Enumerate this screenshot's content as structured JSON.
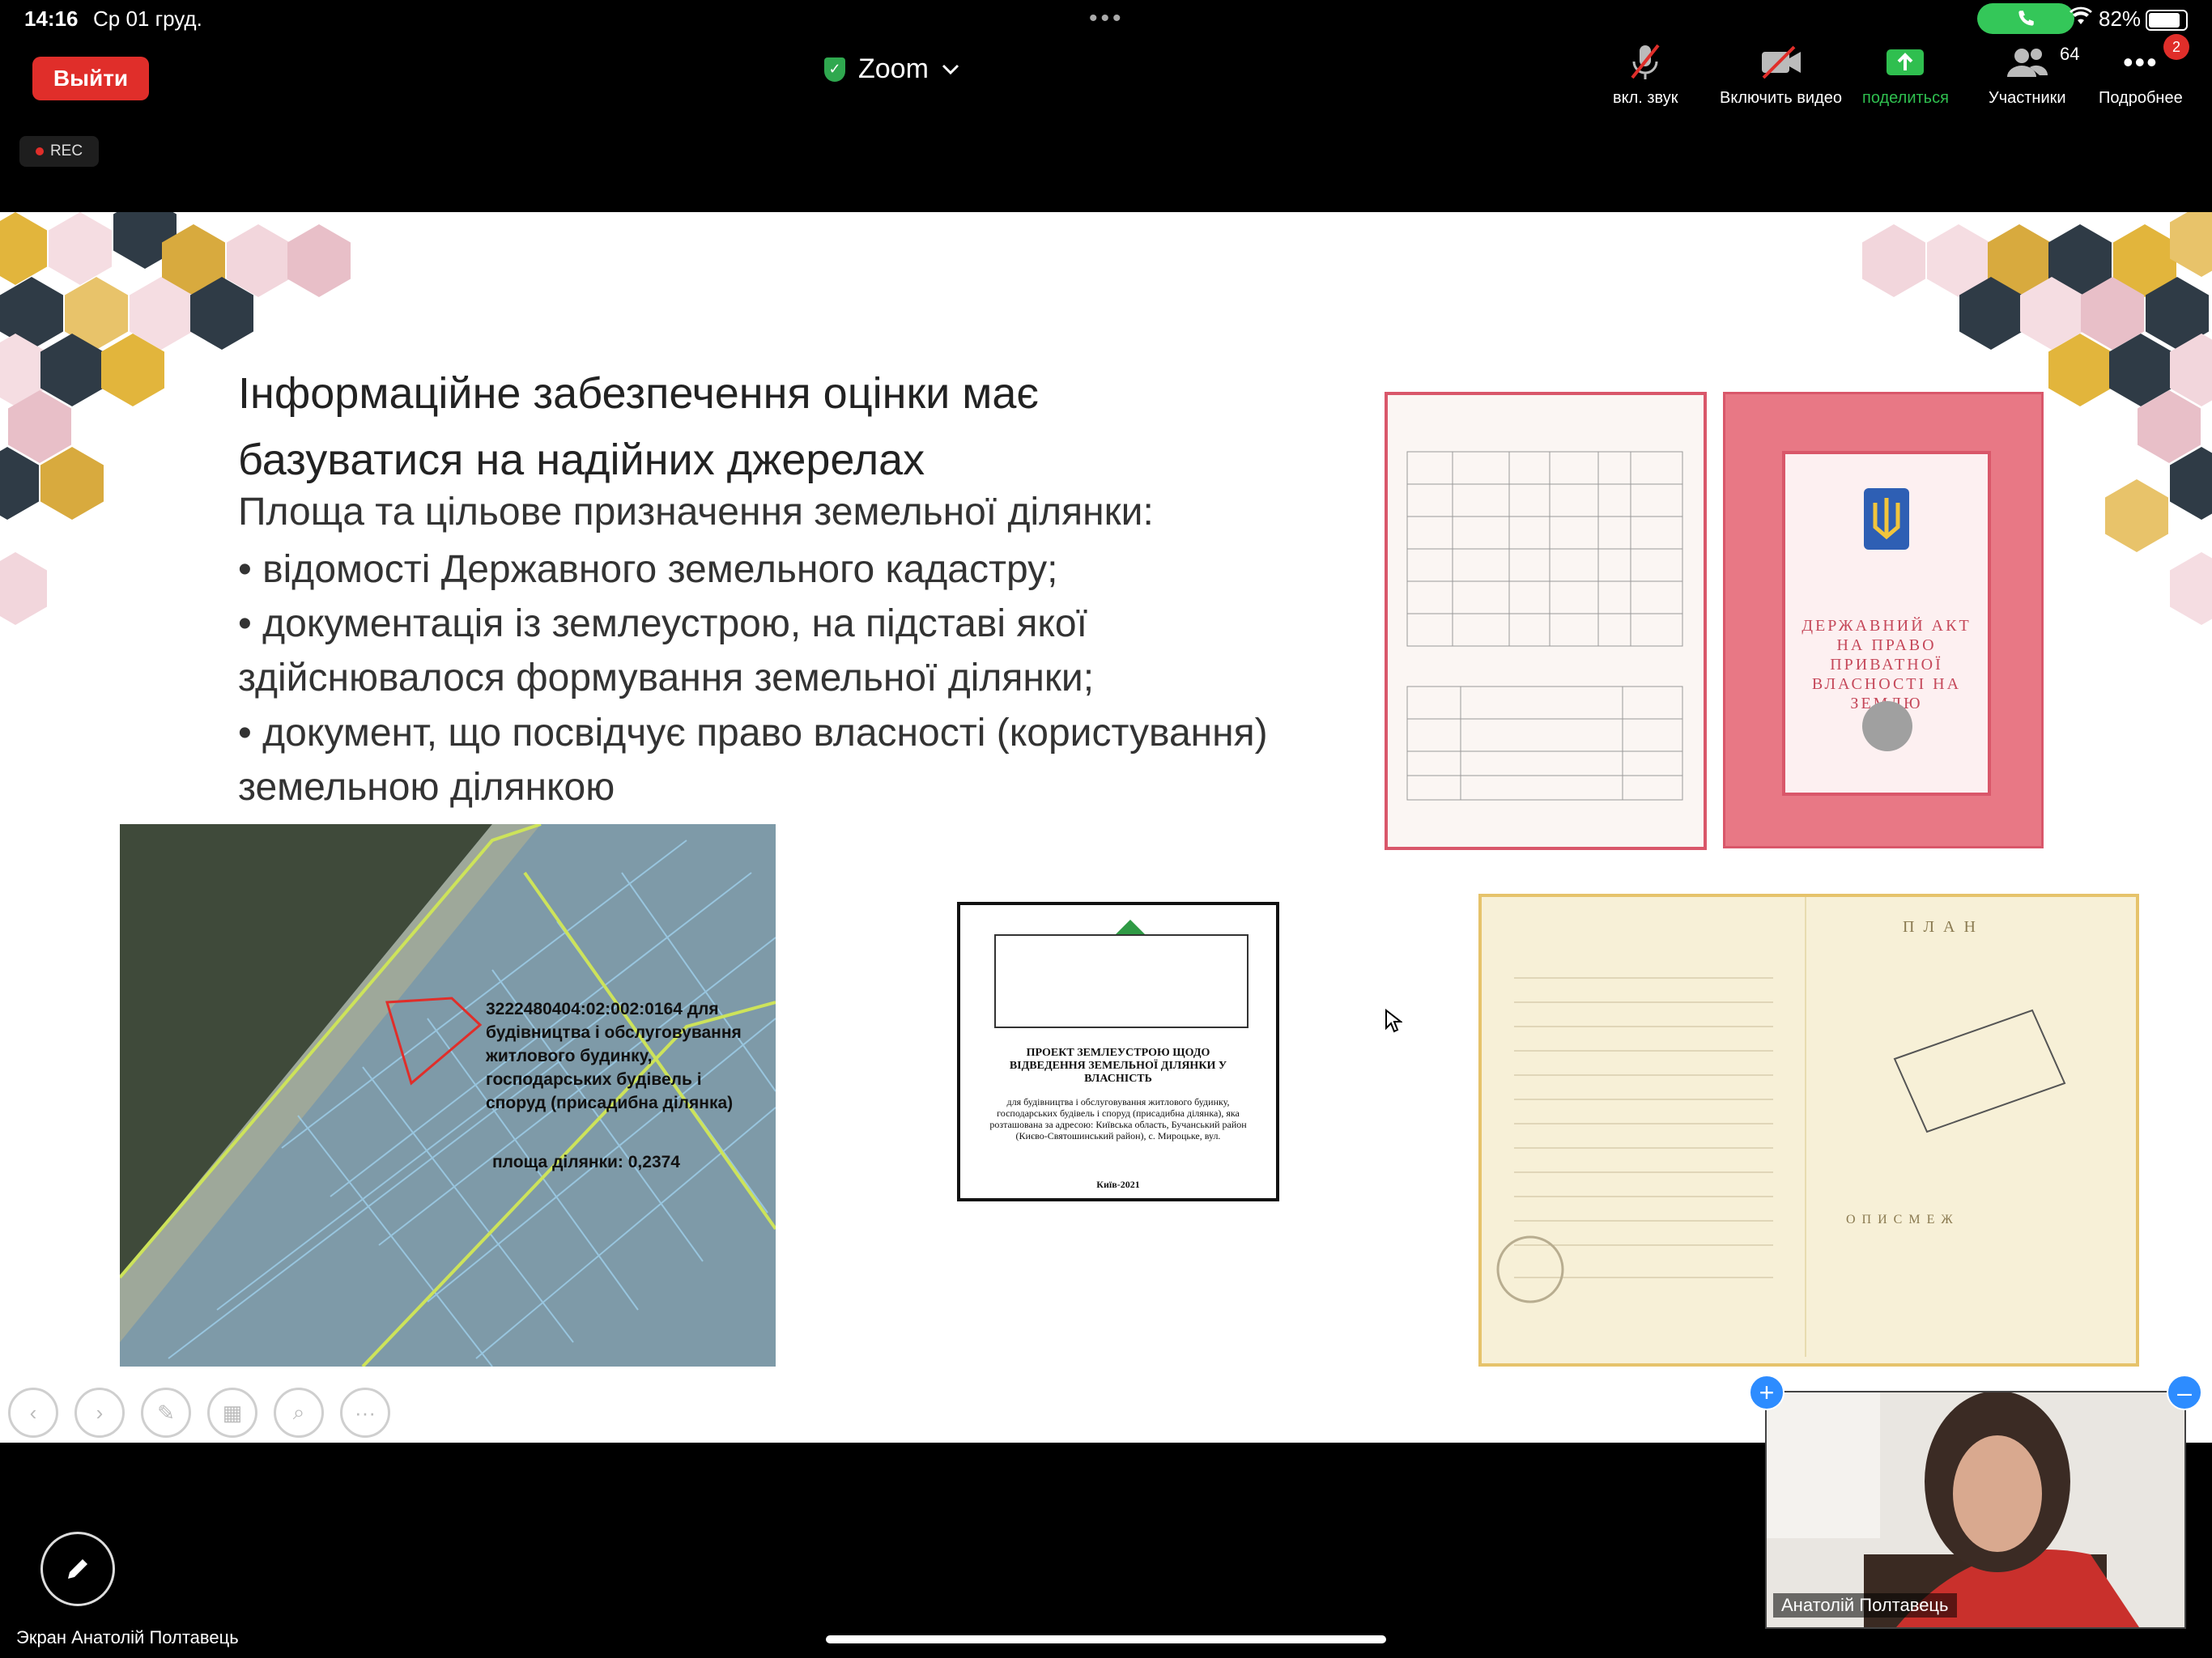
{
  "status_bar": {
    "time": "14:16",
    "date": "Ср 01 груд.",
    "battery_pct": "82%"
  },
  "toolbar": {
    "leave_label": "Выйти",
    "app_title": "Zoom",
    "audio_label": "вкл. звук",
    "video_label": "Включить видео",
    "share_label": "поделиться",
    "participants_label": "Участники",
    "participants_count": "64",
    "more_label": "Подробнее",
    "more_badge": "2"
  },
  "rec_label": "REC",
  "slide": {
    "title_line1": "Інформаційне  забезпечення оцінки має",
    "title_line2": "базуватися на надійних джерелах",
    "subtitle": "Площа та цільове призначення земельної ділянки:",
    "bullet1": "•  відомості Державного земельного кадастру;",
    "bullet2": "•  документація із землеустрою, на підставі якої здійснювалося формування земельної ділянки;",
    "bullet3": "•  документ, що посвідчує право власності (користування) земельною ділянкою",
    "map_label": "3222480404:02:002:0164 для будівництва і обслуговування житлового будинку, господарських будівель і споруд (присадибна ділянка)",
    "map_area": "площа ділянки: 0,2374",
    "plan_doc_title": "ПРОЕКТ ЗЕМЛЕУСТРОЮ ЩОДО ВІДВЕДЕННЯ ЗЕМЕЛЬНОЇ ДІЛЯНКИ У ВЛАСНІСТЬ",
    "plan_doc_body": "для будівництва і обслуговування житлового будинку, господарських будівель і споруд (присадибна ділянка), яка розташована за адресою: Київська область, Бучанський район (Києво-Святошинський район), с. Мироцьке, вул.",
    "plan_doc_footer": "Київ-2021",
    "cert_text": "ДЕРЖАВНИЙ АКТ НА ПРАВО ПРИВАТНОЇ ВЛАСНОСТІ НА ЗЕМЛЮ",
    "act_plan_label": "П Л А Н",
    "act_opys": "О П И С   М Е Ж"
  },
  "video_tile_name": "Анатолій Полтавець",
  "screen_share_label": "Экран Анатолій Полтавець",
  "colors": {
    "leave": "#e02e2a",
    "share_green": "#2fbf4f",
    "accent_blue": "#2d8cff"
  }
}
